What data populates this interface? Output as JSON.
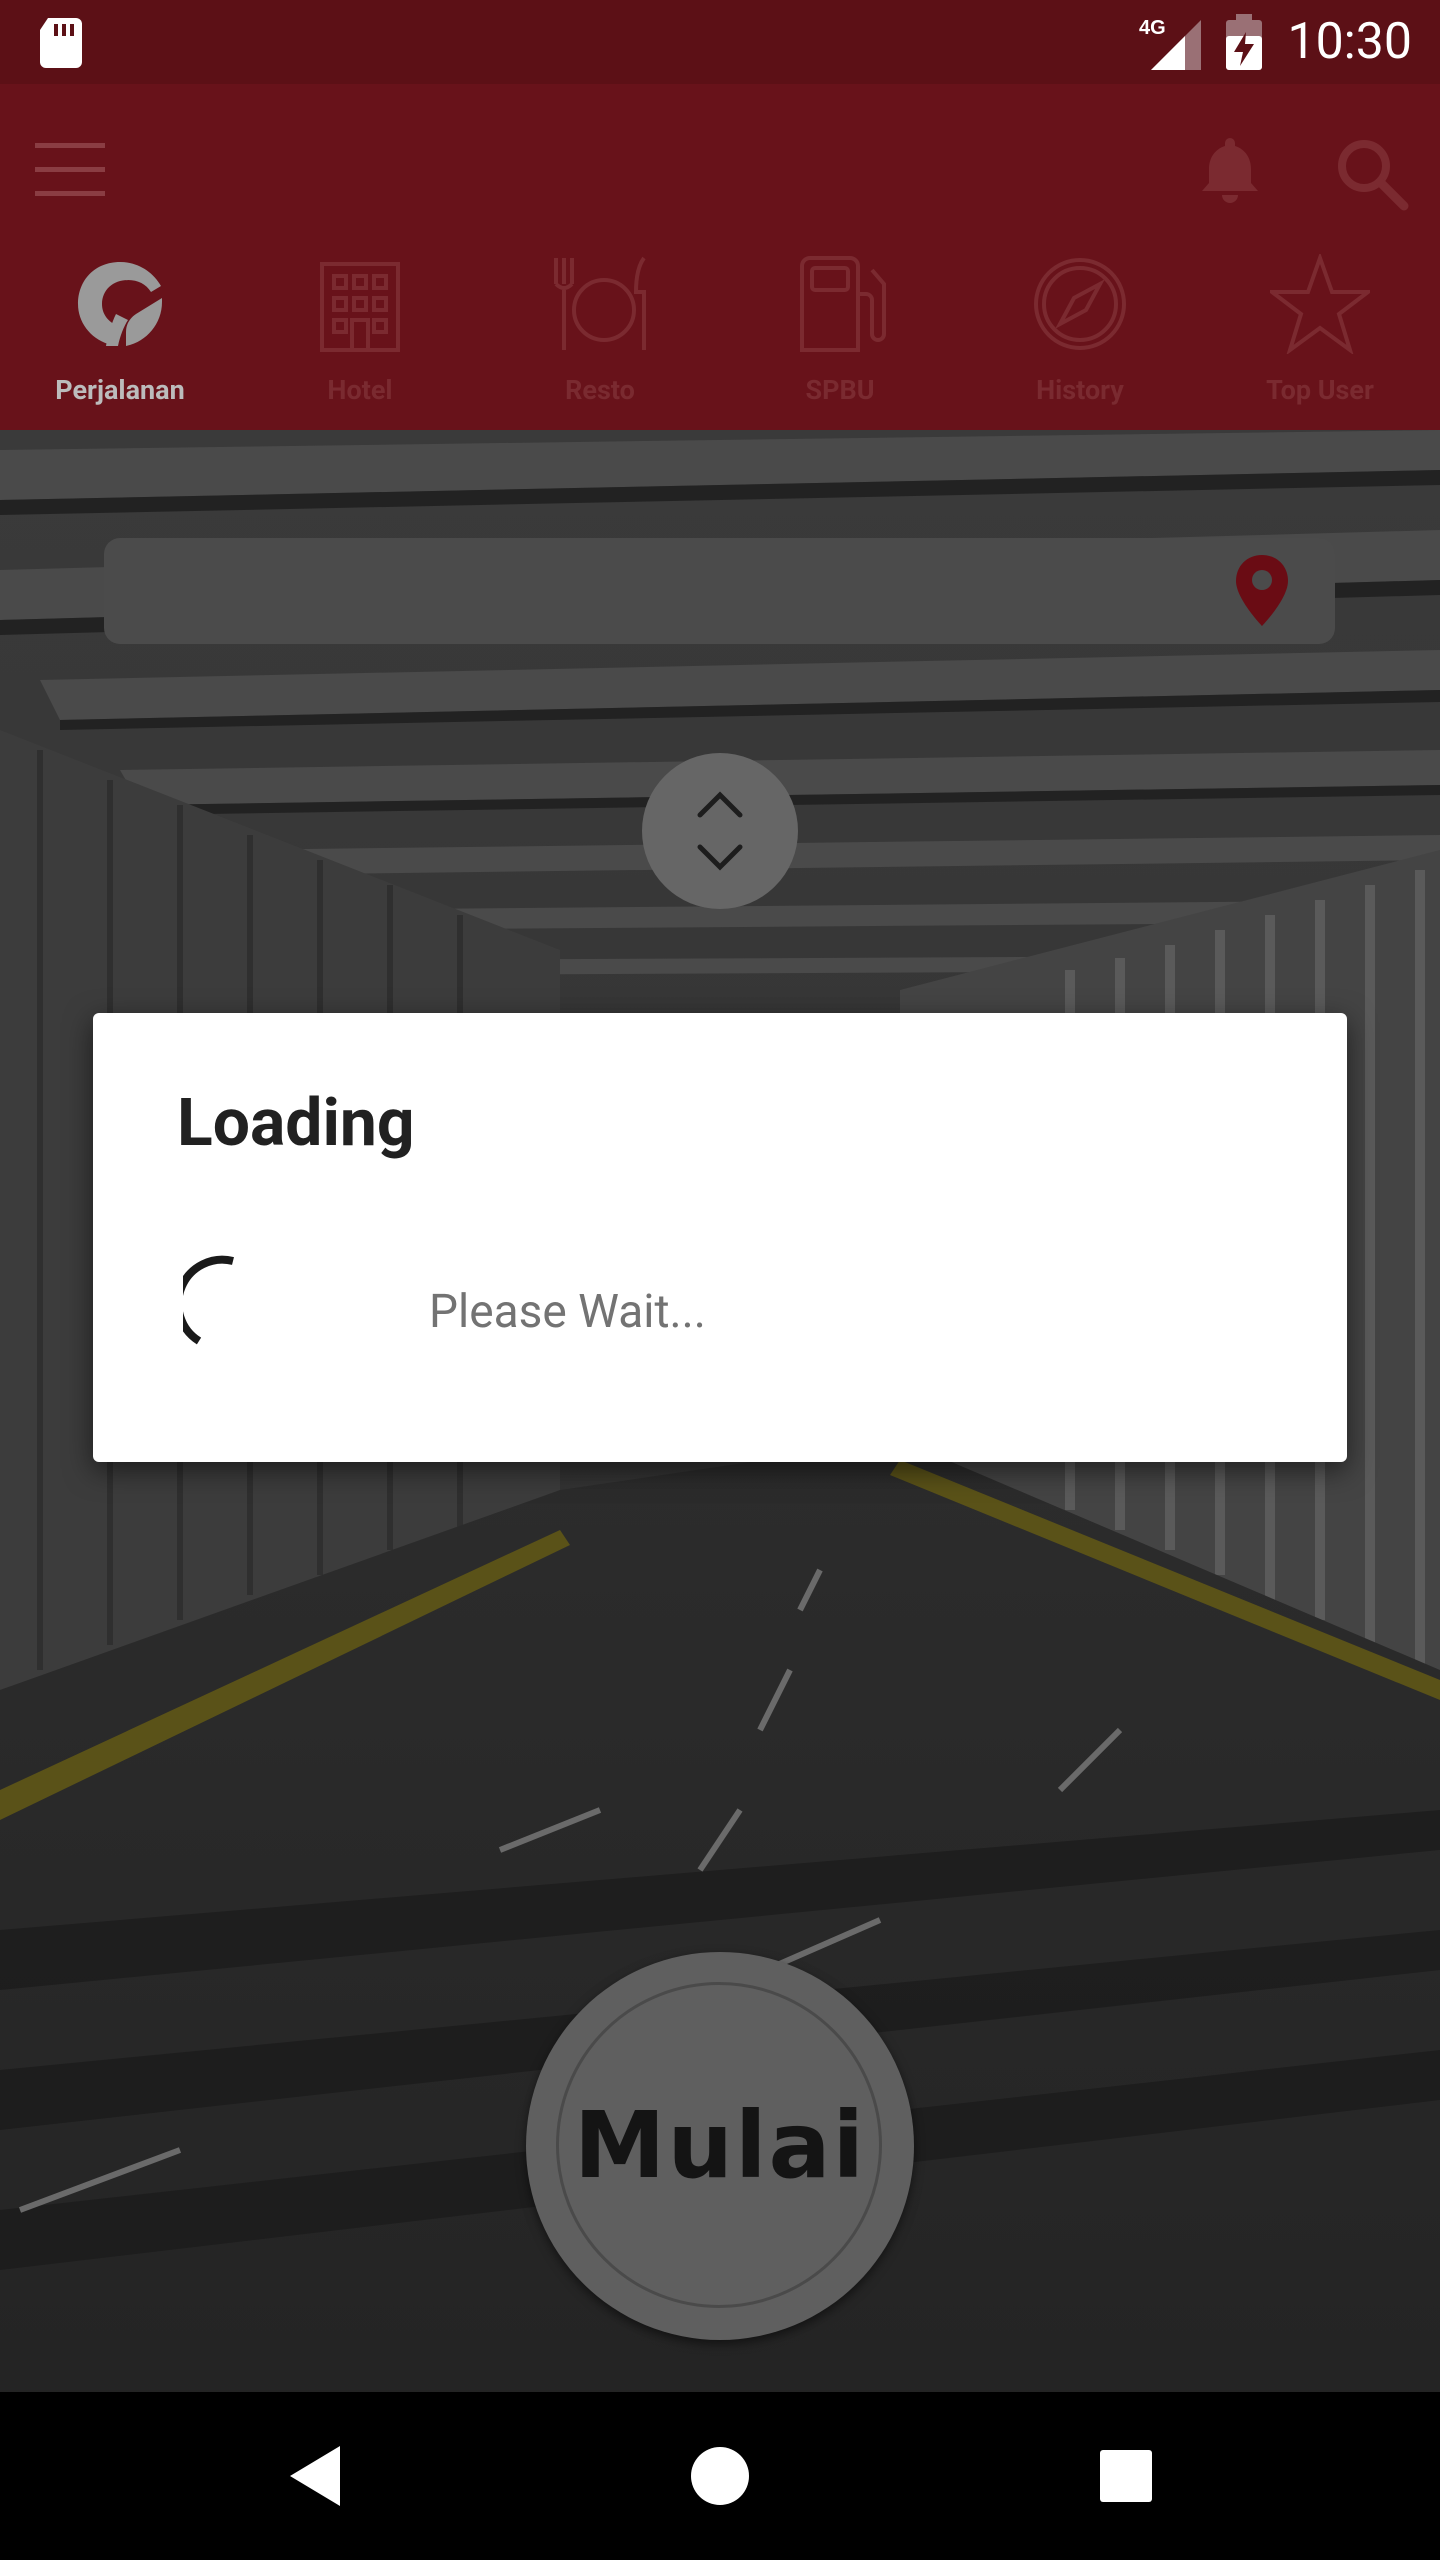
{
  "status_bar": {
    "time": "10:30",
    "network": "4G"
  },
  "app_bar": {
    "tabs": [
      {
        "label": "Perjalanan",
        "icon": "road-helmet-icon",
        "active": true
      },
      {
        "label": "Hotel",
        "icon": "building-icon",
        "active": false
      },
      {
        "label": "Resto",
        "icon": "restaurant-icon",
        "active": false
      },
      {
        "label": "SPBU",
        "icon": "fuel-pump-icon",
        "active": false
      },
      {
        "label": "History",
        "icon": "compass-icon",
        "active": false
      },
      {
        "label": "Top User",
        "icon": "star-icon",
        "active": false
      }
    ]
  },
  "main": {
    "destination_value": "",
    "start_button_label": "Mulai"
  },
  "dialog": {
    "title": "Loading",
    "message": "Please Wait..."
  },
  "colors": {
    "status_bar": "#5c1016",
    "app_bar": "#68121a",
    "pin": "#b0141e"
  }
}
